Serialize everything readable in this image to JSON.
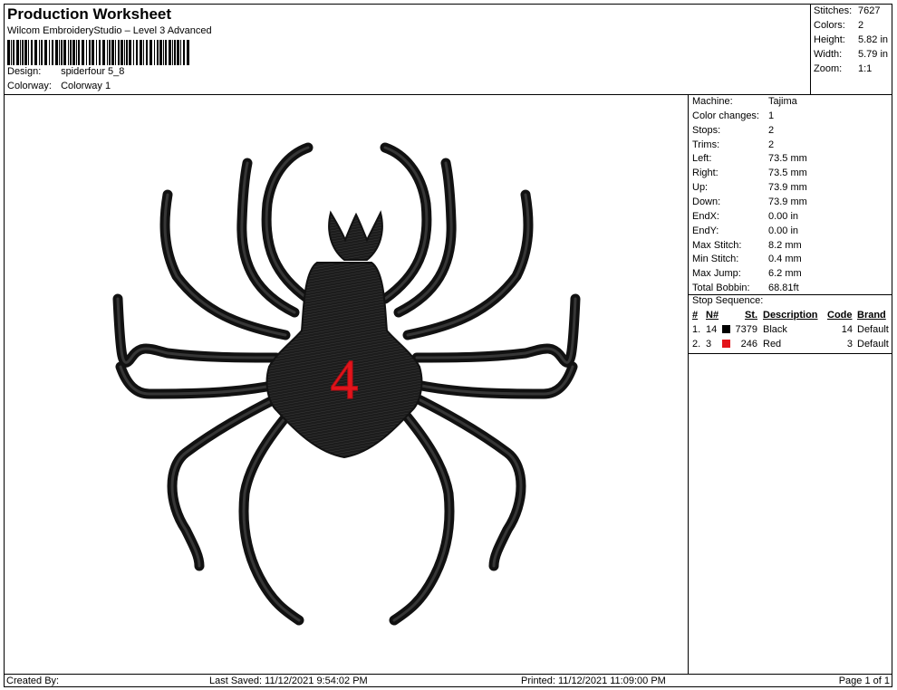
{
  "header": {
    "title": "Production Worksheet",
    "software": "Wilcom EmbroideryStudio – Level 3 Advanced",
    "design_label": "Design:",
    "design_value": "spiderfour 5_8",
    "colorway_label": "Colorway:",
    "colorway_value": "Colorway 1"
  },
  "stats": [
    {
      "label": "Stitches:",
      "value": "7627"
    },
    {
      "label": "Colors:",
      "value": "2"
    },
    {
      "label": "Height:",
      "value": "5.82 in"
    },
    {
      "label": "Width:",
      "value": "5.79 in"
    },
    {
      "label": "Zoom:",
      "value": "1:1"
    }
  ],
  "machine_info": [
    {
      "label": "Machine:",
      "value": "Tajima"
    },
    {
      "label": "Color changes:",
      "value": "1"
    },
    {
      "label": "Stops:",
      "value": "2"
    },
    {
      "label": "Trims:",
      "value": "2"
    },
    {
      "label": "Left:",
      "value": "73.5 mm"
    },
    {
      "label": "Right:",
      "value": "73.5 mm"
    },
    {
      "label": "Up:",
      "value": "73.9 mm"
    },
    {
      "label": "Down:",
      "value": "73.9 mm"
    },
    {
      "label": "EndX:",
      "value": "0.00 in"
    },
    {
      "label": "EndY:",
      "value": "0.00 in"
    },
    {
      "label": "Max Stitch:",
      "value": "8.2 mm"
    },
    {
      "label": "Min Stitch:",
      "value": "0.4 mm"
    },
    {
      "label": "Max Jump:",
      "value": "6.2 mm"
    },
    {
      "label": "Total Bobbin:",
      "value": "68.81ft"
    }
  ],
  "stop_sequence": {
    "title": "Stop Sequence:",
    "headers": {
      "num": "#",
      "n": "N#",
      "st": "St.",
      "description": "Description",
      "code": "Code",
      "brand": "Brand"
    },
    "rows": [
      {
        "num": "1.",
        "n": "14",
        "color": "#000000",
        "st": "7379",
        "description": "Black",
        "code": "14",
        "brand": "Default"
      },
      {
        "num": "2.",
        "n": "3",
        "color": "#e3141b",
        "st": "246",
        "description": "Red",
        "code": "3",
        "brand": "Default"
      }
    ]
  },
  "design": {
    "number_text": "4",
    "thread_black": "#1a1a1a",
    "thread_red": "#e3141b"
  },
  "footer": {
    "created_by": "Created By:",
    "last_saved": "Last Saved: 11/12/2021 9:54:02 PM",
    "printed": "Printed: 11/12/2021 11:09:00 PM",
    "page": "Page 1 of 1"
  }
}
